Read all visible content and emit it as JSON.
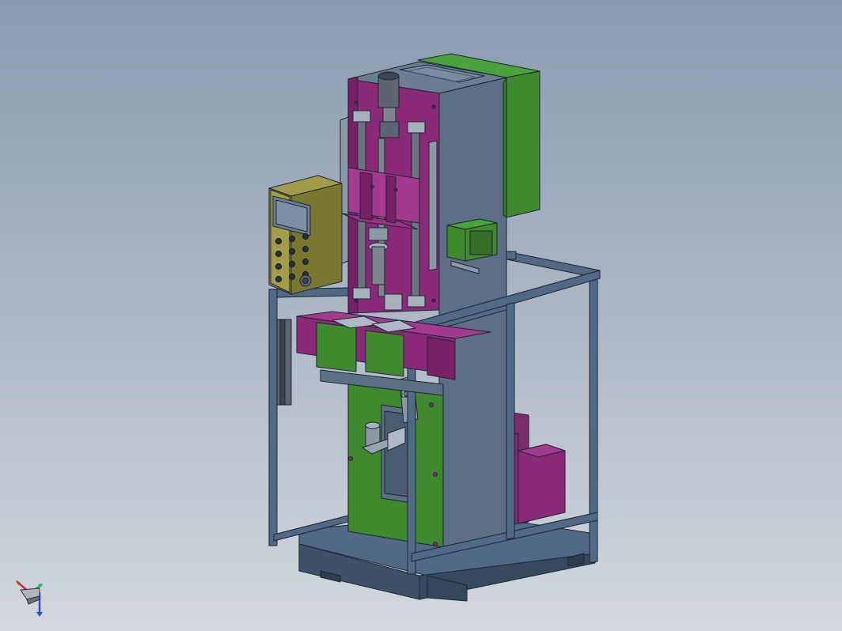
{
  "viewport": {
    "background_top": "#8a9bb0",
    "background_bottom": "#d3d8de"
  },
  "model": {
    "colors": {
      "steel_frame": "#4f6987",
      "column": "#5c6f86",
      "column_dark": "#46586d",
      "base": "#3d526a",
      "green_part": "#3f8a2e",
      "green_light": "#4aa33a",
      "magenta_part": "#8a2a78",
      "magenta_light": "#a43a90",
      "control_box": "#8c8a3e",
      "hmi_screen": "#6f7f93",
      "edge": "#1e2630"
    },
    "control_panel": {
      "button_count": 12,
      "knob_count": 1
    }
  },
  "triad": {
    "axes": [
      "X",
      "Y",
      "Z"
    ],
    "x_color": "#c0392b",
    "y_color": "#27ae60",
    "z_color": "#2a4fd6"
  }
}
